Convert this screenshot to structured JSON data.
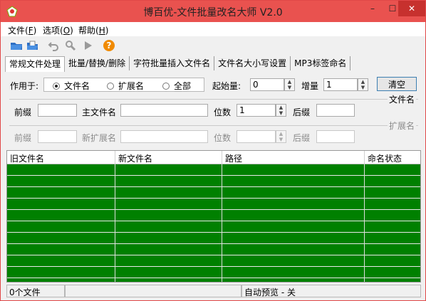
{
  "window": {
    "title": "博百优-文件批量改名大师 V2.0",
    "controls": {
      "minimize": "–",
      "maximize": "☐",
      "close": "✕"
    }
  },
  "menu": {
    "file": {
      "label": "文件",
      "key": "F"
    },
    "options": {
      "label": "选项",
      "key": "O"
    },
    "help": {
      "label": "帮助",
      "key": "H"
    }
  },
  "toolbar": {
    "icons": [
      "open-folder-icon",
      "open-file-icon",
      "undo-icon",
      "search-icon",
      "play-icon",
      "help-icon"
    ]
  },
  "tabs": [
    {
      "label": "常规文件处理"
    },
    {
      "label": "批量/替换/删除"
    },
    {
      "label": "字符批量插入文件名"
    },
    {
      "label": "文件名大小写设置"
    },
    {
      "label": "MP3标签命名"
    }
  ],
  "apply_to": {
    "label": "作用于:",
    "options": [
      {
        "label": "文件名",
        "selected": true
      },
      {
        "label": "扩展名",
        "selected": false
      },
      {
        "label": "全部",
        "selected": false
      }
    ]
  },
  "start_value": {
    "label": "起始量:",
    "value": "0"
  },
  "increment": {
    "label": "增量",
    "value": "1"
  },
  "clear_button": {
    "label": "清空"
  },
  "filename_group": {
    "title": "文件名",
    "prefix": {
      "label": "前缀",
      "value": ""
    },
    "main_name": {
      "label": "主文件名",
      "value": ""
    },
    "digits": {
      "label": "位数",
      "value": "1"
    },
    "suffix": {
      "label": "后缀",
      "value": ""
    }
  },
  "extension_group": {
    "title": "扩展名",
    "prefix": {
      "label": "前缀",
      "value": ""
    },
    "new_ext": {
      "label": "新扩展名",
      "value": ""
    },
    "digits": {
      "label": "位数",
      "value": ""
    },
    "suffix": {
      "label": "后缀",
      "value": ""
    }
  },
  "table": {
    "columns": [
      "旧文件名",
      "新文件名",
      "路径",
      "命名状态"
    ],
    "row_color": "#008000"
  },
  "status": {
    "file_count": "0个文件",
    "middle": "",
    "preview": "自动预览 - 关"
  }
}
